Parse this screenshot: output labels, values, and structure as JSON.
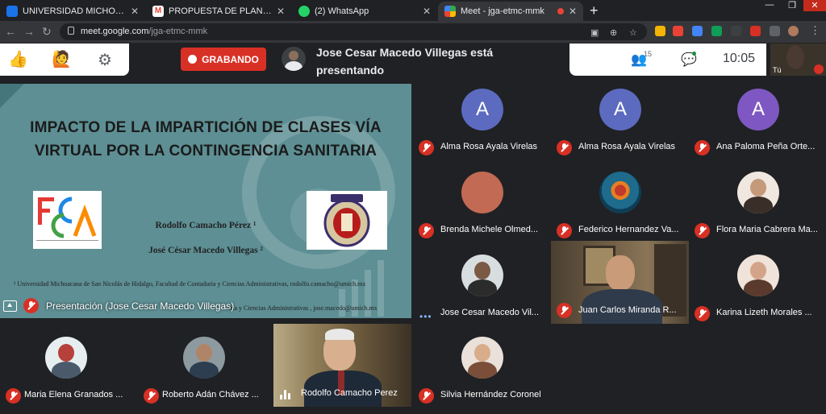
{
  "browser": {
    "tabs": [
      {
        "title": "UNIVERSIDAD MICHOACANA DE",
        "favicon_color": "#1a73e8",
        "active": false
      },
      {
        "title": "PROPUESTA DE PLAN DE TRABA",
        "favicon_color": "#ea4335",
        "active": false
      },
      {
        "title": "(2) WhatsApp",
        "favicon_color": "#25d366",
        "active": false
      },
      {
        "title": "Meet - jga-etmc-mmk",
        "favicon_color": "#00897b",
        "active": true
      }
    ],
    "url_host": "meet.google.com",
    "url_path": "/jga-etmc-mmk"
  },
  "toolbar": {
    "recording_label": "GRABANDO",
    "presenting_text": "Jose Cesar Macedo Villegas está presentando",
    "participant_count": "15",
    "clock": "10:05",
    "self_label": "Tú"
  },
  "presentation": {
    "label": "Presentación (Jose Cesar Macedo Villegas)",
    "title": "IMPACTO DE LA IMPARTICIÓN DE CLASES VÍA VIRTUAL POR LA CONTINGENCIA SANITARIA",
    "author1": "Rodolfo Camacho Pérez ¹",
    "author2": "José César Macedo Villegas ²",
    "footnote1": "¹ Universidad Michoacana de San Nicolás de Hidalgo, Facultad de Contaduría y Ciencias Administrativas, rodolfo.camacho@umich.mx",
    "footnote2": "aría y Ciencias Administrativas , jose.macedo@umich.mx",
    "logo_left_text": "Facultad de Contaduría y Ciencias Administrativas"
  },
  "participants": [
    {
      "name": "Alma Rosa Ayala Virelas",
      "initial": "A",
      "color": "#5c6bc0",
      "status": "muted"
    },
    {
      "name": "Alma Rosa Ayala Virelas",
      "initial": "A",
      "color": "#5c6bc0",
      "status": "muted"
    },
    {
      "name": "Ana Paloma Peña Orte...",
      "initial": "A",
      "color": "#7e57c2",
      "status": "muted"
    },
    {
      "name": "Brenda Michele Olmed...",
      "initial": "",
      "color": "#c26a54",
      "status": "muted"
    },
    {
      "name": "Federico Hernandez Va...",
      "initial": "",
      "color": "#1e6b8c",
      "status": "muted"
    },
    {
      "name": "Flora Maria Cabrera Ma...",
      "initial": "",
      "color": "#d9c3b3",
      "status": "muted"
    },
    {
      "name": "Jose Cesar Macedo Vil...",
      "initial": "",
      "color": "#d8dde0",
      "status": "active"
    },
    {
      "name": "Juan Carlos Miranda R...",
      "initial": "",
      "color": "#6b5a45",
      "status": "muted"
    },
    {
      "name": "Karina Lizeth Morales ...",
      "initial": "",
      "color": "#e6d6cc",
      "status": "muted"
    },
    {
      "name": "Silvia Hernández Coronel",
      "initial": "",
      "color": "#e0d4ca",
      "status": "muted"
    },
    {
      "name": "Maria Elena Granados ...",
      "initial": "",
      "color": "#cfd8dc",
      "status": "muted"
    },
    {
      "name": "Roberto Adán Chávez ...",
      "initial": "",
      "color": "#7a8a8f",
      "status": "muted"
    },
    {
      "name": "Rodolfo Camacho Perez",
      "initial": "",
      "color": "#6d5c3e",
      "status": "speaking"
    }
  ],
  "colors": {
    "mute_red": "#d93025",
    "meet_bg": "#202124",
    "slide_bg": "#5d8f94"
  }
}
